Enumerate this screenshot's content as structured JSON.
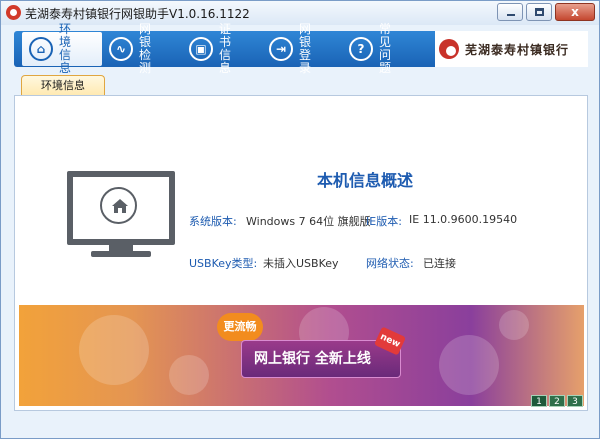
{
  "window": {
    "title": "芜湖泰寿村镇银行网银助手V1.0.16.1122",
    "close_label": "x"
  },
  "nav": {
    "items": [
      {
        "label": "环境信息",
        "icon": "house-icon"
      },
      {
        "label": "网银检测",
        "icon": "stethoscope-icon"
      },
      {
        "label": "证书信息",
        "icon": "certificate-icon"
      },
      {
        "label": "网银登录",
        "icon": "login-icon"
      },
      {
        "label": "常见问题",
        "icon": "question-icon"
      }
    ],
    "icon_glyphs": [
      "⌂",
      "∿",
      "▣",
      "⇥",
      "?"
    ]
  },
  "brand": {
    "name": "芜湖泰寿村镇银行"
  },
  "tab": {
    "label": "环境信息"
  },
  "overview": {
    "title": "本机信息概述",
    "rows": [
      {
        "label": "系统版本:",
        "value": "Windows 7 64位 旗舰版"
      },
      {
        "label": "IE版本:",
        "value": "IE 11.0.9600.19540"
      },
      {
        "label": "USBKey类型:",
        "value": "未插入USBKey"
      },
      {
        "label": "网络状态:",
        "value": "已连接"
      }
    ]
  },
  "banner": {
    "sticker": "更流畅",
    "headline": "网上银行 全新上线",
    "new_tag": "new",
    "pages": [
      "1",
      "2",
      "3"
    ],
    "current_page": "1"
  },
  "colors": {
    "accent": "#1d5bb0",
    "tab_border": "#f2a11d",
    "nav_bg": "#1a63b5"
  }
}
